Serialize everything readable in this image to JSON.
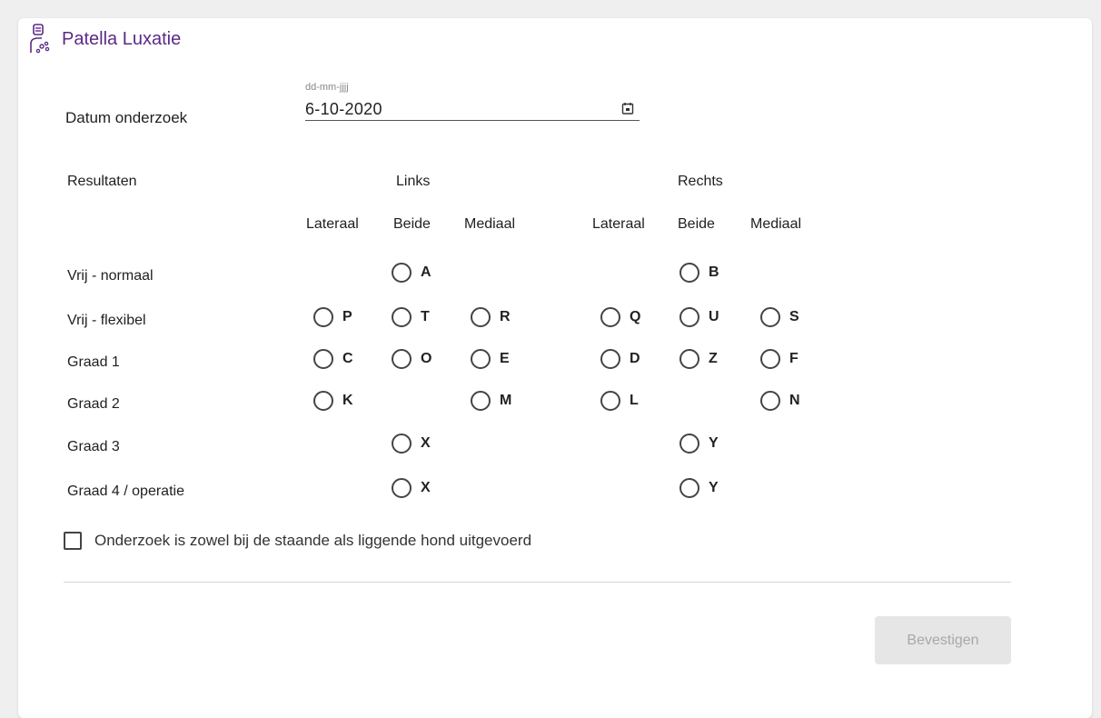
{
  "header": {
    "title": "Patella Luxatie",
    "icon": "veterinary-person-icon"
  },
  "date": {
    "label": "Datum onderzoek",
    "placeholder": "dd-mm-jjjj",
    "value": "6-10-2020",
    "icon": "calendar-icon"
  },
  "results": {
    "label": "Resultaten",
    "left_label": "Links",
    "right_label": "Rechts",
    "subheaders": [
      "Lateraal",
      "Beide",
      "Mediaal",
      "Lateraal",
      "Beide",
      "Mediaal"
    ],
    "rows": [
      {
        "label": "Vrij - normaal",
        "cells": [
          "",
          "A",
          "",
          "",
          "B",
          ""
        ]
      },
      {
        "label": "Vrij - flexibel",
        "cells": [
          "P",
          "T",
          "R",
          "Q",
          "U",
          "S"
        ]
      },
      {
        "label": "Graad 1",
        "cells": [
          "C",
          "O",
          "E",
          "D",
          "Z",
          "F"
        ]
      },
      {
        "label": "Graad 2",
        "cells": [
          "K",
          "",
          "M",
          "L",
          "",
          "N"
        ]
      },
      {
        "label": "Graad 3",
        "cells": [
          "",
          "X",
          "",
          "",
          "Y",
          ""
        ]
      },
      {
        "label": "Graad 4 / operatie",
        "cells": [
          "",
          "X",
          "",
          "",
          "Y",
          ""
        ]
      }
    ]
  },
  "checkbox": {
    "label": "Onderzoek is zowel bij de staande als liggende hond uitgevoerd",
    "checked": false
  },
  "confirm": {
    "label": "Bevestigen",
    "enabled": false
  },
  "colors": {
    "accent": "#5b2a86",
    "button_bg": "#e6e6e6",
    "button_text": "#a8a8a8"
  }
}
